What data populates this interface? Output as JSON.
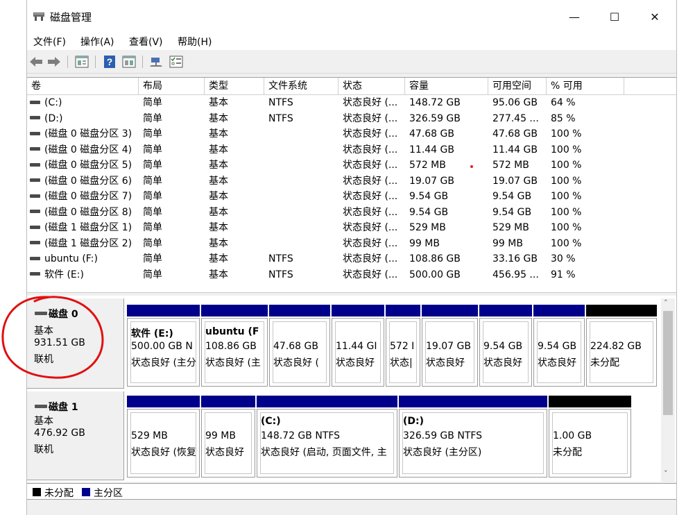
{
  "window": {
    "title": "磁盘管理",
    "minimize_glyph": "—",
    "maximize_glyph": "☐",
    "close_glyph": "✕"
  },
  "menu": [
    "文件(F)",
    "操作(A)",
    "查看(V)",
    "帮助(H)"
  ],
  "toolbar": {
    "icons": [
      "back-icon",
      "forward-icon",
      "properties-icon",
      "help-icon",
      "view-icon",
      "connect-icon",
      "checklist-icon"
    ]
  },
  "volumes": {
    "columns": [
      "卷",
      "布局",
      "类型",
      "文件系统",
      "状态",
      "容量",
      "可用空间",
      "% 可用"
    ],
    "rows": [
      [
        "(C:)",
        "简单",
        "基本",
        "NTFS",
        "状态良好 (...",
        "148.72 GB",
        "95.06 GB",
        "64 %"
      ],
      [
        "(D:)",
        "简单",
        "基本",
        "NTFS",
        "状态良好 (...",
        "326.59 GB",
        "277.45 ...",
        "85 %"
      ],
      [
        "(磁盘 0 磁盘分区 3)",
        "简单",
        "基本",
        "",
        "状态良好 (...",
        "47.68 GB",
        "47.68 GB",
        "100 %"
      ],
      [
        "(磁盘 0 磁盘分区 4)",
        "简单",
        "基本",
        "",
        "状态良好 (...",
        "11.44 GB",
        "11.44 GB",
        "100 %"
      ],
      [
        "(磁盘 0 磁盘分区 5)",
        "简单",
        "基本",
        "",
        "状态良好 (...",
        "572 MB",
        "572 MB",
        "100 %"
      ],
      [
        "(磁盘 0 磁盘分区 6)",
        "简单",
        "基本",
        "",
        "状态良好 (...",
        "19.07 GB",
        "19.07 GB",
        "100 %"
      ],
      [
        "(磁盘 0 磁盘分区 7)",
        "简单",
        "基本",
        "",
        "状态良好 (...",
        "9.54 GB",
        "9.54 GB",
        "100 %"
      ],
      [
        "(磁盘 0 磁盘分区 8)",
        "简单",
        "基本",
        "",
        "状态良好 (...",
        "9.54 GB",
        "9.54 GB",
        "100 %"
      ],
      [
        "(磁盘 1 磁盘分区 1)",
        "简单",
        "基本",
        "",
        "状态良好 (...",
        "529 MB",
        "529 MB",
        "100 %"
      ],
      [
        "(磁盘 1 磁盘分区 2)",
        "简单",
        "基本",
        "",
        "状态良好 (...",
        "99 MB",
        "99 MB",
        "100 %"
      ],
      [
        "ubuntu (F:)",
        "简单",
        "基本",
        "NTFS",
        "状态良好 (...",
        "108.86 GB",
        "33.16 GB",
        "30 %"
      ],
      [
        "软件 (E:)",
        "简单",
        "基本",
        "NTFS",
        "状态良好 (...",
        "500.00 GB",
        "456.95 ...",
        "91 %"
      ]
    ]
  },
  "disks": [
    {
      "name": "磁盘 0",
      "type": "基本",
      "size": "931.51 GB",
      "status": "联机",
      "partitions": [
        {
          "kind": "primary",
          "name": "软件 (E:)",
          "size": "500.00 GB N",
          "status": "状态良好 (主分"
        },
        {
          "kind": "primary",
          "name": "ubuntu (F",
          "size": "108.86 GB",
          "status": "状态良好 (主"
        },
        {
          "kind": "primary",
          "name": "",
          "size": "47.68 GB",
          "status": "状态良好 ("
        },
        {
          "kind": "primary",
          "name": "",
          "size": "11.44 GI",
          "status": "状态良好"
        },
        {
          "kind": "primary",
          "name": "",
          "size": "572 I",
          "status": "状态|"
        },
        {
          "kind": "primary",
          "name": "",
          "size": "19.07 GB",
          "status": "状态良好"
        },
        {
          "kind": "primary",
          "name": "",
          "size": "9.54 GB",
          "status": "状态良好"
        },
        {
          "kind": "primary",
          "name": "",
          "size": "9.54 GB",
          "status": "状态良好"
        },
        {
          "kind": "unallocated",
          "name": "",
          "size": "224.82 GB",
          "status": "未分配"
        }
      ]
    },
    {
      "name": "磁盘 1",
      "type": "基本",
      "size": "476.92 GB",
      "status": "联机",
      "partitions": [
        {
          "kind": "primary",
          "name": "",
          "size": "529 MB",
          "status": "状态良好 (恢复"
        },
        {
          "kind": "primary",
          "name": "",
          "size": "99 MB",
          "status": "状态良好"
        },
        {
          "kind": "primary",
          "name": "(C:)",
          "size": "148.72 GB NTFS",
          "status": "状态良好 (启动, 页面文件, 主"
        },
        {
          "kind": "primary",
          "name": "(D:)",
          "size": "326.59 GB NTFS",
          "status": "状态良好 (主分区)"
        },
        {
          "kind": "unallocated",
          "name": "",
          "size": "1.00 GB",
          "status": "未分配"
        }
      ]
    }
  ],
  "legend": [
    {
      "label": "未分配",
      "color": "#000000"
    },
    {
      "label": "主分区",
      "color": "#00008b"
    }
  ],
  "colors": {
    "primary": "#00008b",
    "unallocated": "#000000",
    "annotation": "#e01010"
  },
  "scrollbar": {
    "up_glyph": "˄",
    "down_glyph": "˅"
  }
}
